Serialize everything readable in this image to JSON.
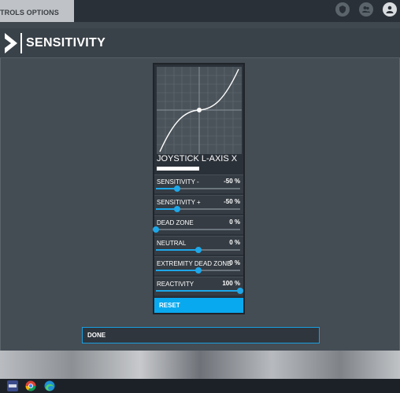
{
  "window": {
    "tab_label": "TROLS OPTIONS"
  },
  "top_icons": [
    "shield-icon",
    "people-icon",
    "user-icon"
  ],
  "header": {
    "title": "SENSITIVITY"
  },
  "panel": {
    "axis_title": "JOYSTICK L-AXIS X",
    "axis_input_level": 0.5,
    "settings": [
      {
        "label": "SENSITIVITY -",
        "value": "-50 %",
        "level": 0.25
      },
      {
        "label": "SENSITIVITY +",
        "value": "-50 %",
        "level": 0.25
      },
      {
        "label": "DEAD ZONE",
        "value": "0 %",
        "level": 0.0
      },
      {
        "label": "NEUTRAL",
        "value": "0 %",
        "level": 0.5
      },
      {
        "label": "EXTREMITY DEAD ZONE",
        "value": "0 %",
        "level": 0.5
      },
      {
        "label": "REACTIVITY",
        "value": "100 %",
        "level": 1.0
      }
    ],
    "reset_label": "RESET"
  },
  "done_label": "DONE",
  "colors": {
    "accent": "#1ea7e8",
    "reset_bg": "#09a9ef",
    "panel_bg": "#2b3138",
    "page_bg": "#444c54"
  },
  "taskbar_icons": [
    "flight-sim-icon",
    "chrome-icon",
    "edge-icon"
  ]
}
